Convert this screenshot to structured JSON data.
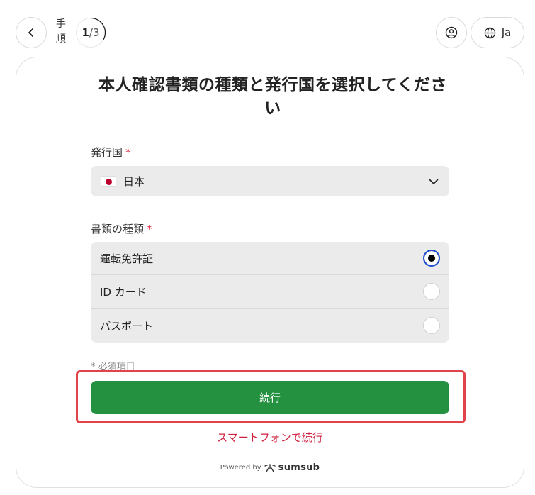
{
  "header": {
    "step_label": "手順",
    "step_current": "1",
    "step_separator": "/",
    "step_total": "3",
    "language": "Ja"
  },
  "form": {
    "title": "本人確認書類の種類と発行国を選択してください",
    "country": {
      "label": "発行国",
      "required_mark": "*",
      "selected": "日本",
      "flag": "japan-flag-icon"
    },
    "document_type": {
      "label": "書類の種類",
      "required_mark": "*",
      "options": [
        {
          "label": "運転免許証",
          "selected": true
        },
        {
          "label": "ID カード",
          "selected": false
        },
        {
          "label": "パスポート",
          "selected": false
        }
      ]
    },
    "required_note": "* 必須項目",
    "continue_label": "続行",
    "phone_link": "スマートフォンで続行"
  },
  "footer": {
    "powered_by": "Powered by",
    "brand": "sumsub"
  },
  "colors": {
    "accent_green": "#23913f",
    "required_red": "#e0203a",
    "link_red": "#d01f3f",
    "highlight_red": "#e0444a",
    "option_bg": "#ebebeb"
  },
  "icons": [
    "chevron-left-icon",
    "user-circle-icon",
    "globe-icon",
    "chevron-down-icon",
    "sumsub-logo-icon"
  ]
}
